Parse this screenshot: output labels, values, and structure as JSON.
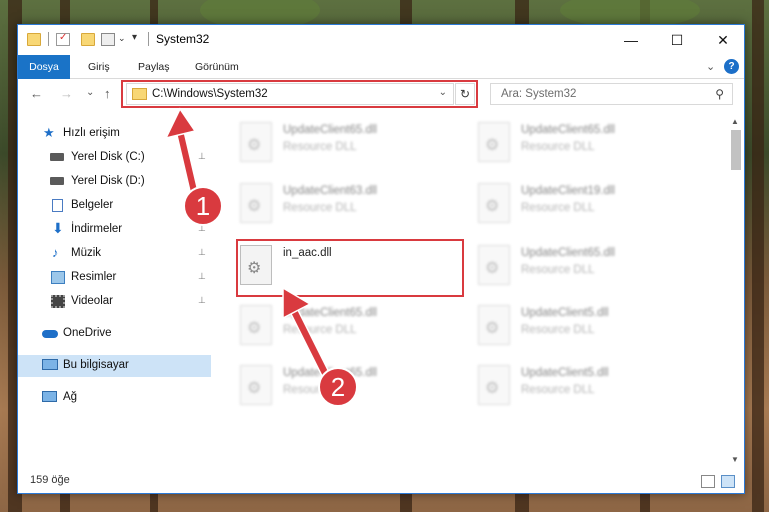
{
  "window": {
    "title": "System32",
    "controls": {
      "minimize": "—",
      "maximize": "☐",
      "close": "✕"
    }
  },
  "ribbon": {
    "tabs": [
      "Dosya",
      "Giriş",
      "Paylaş",
      "Görünüm"
    ],
    "collapse_glyph": "⌄",
    "help_glyph": "?"
  },
  "navigation": {
    "back": "←",
    "forward": "→",
    "recent": "⌄",
    "up": "↑",
    "address_path": "C:\\Windows\\System32",
    "address_dropdown": "⌄",
    "refresh": "↻",
    "search_placeholder": "Ara: System32",
    "search_icon": "⚲"
  },
  "sidebar": {
    "items": [
      {
        "label": "Hızlı erişim",
        "icon": "star-icon",
        "color": "#1e6fc8",
        "pinned": false
      },
      {
        "label": "Yerel Disk (C:)",
        "icon": "drive-icon",
        "color": "#5a5a5a",
        "pinned": true
      },
      {
        "label": "Yerel Disk (D:)",
        "icon": "drive-icon",
        "color": "#5a5a5a",
        "pinned": true
      },
      {
        "label": "Belgeler",
        "icon": "documents-icon",
        "color": "#4a7bc2",
        "pinned": true
      },
      {
        "label": "İndirmeler",
        "icon": "downloads-icon",
        "color": "#1e6fc8",
        "pinned": true
      },
      {
        "label": "Müzik",
        "icon": "music-icon",
        "color": "#1e6fc8",
        "pinned": true
      },
      {
        "label": "Resimler",
        "icon": "pictures-icon",
        "color": "#3d7fc0",
        "pinned": true
      },
      {
        "label": "Videolar",
        "icon": "videos-icon",
        "color": "#444444",
        "pinned": true
      },
      {
        "label": "OneDrive",
        "icon": "cloud-icon",
        "color": "#1e6fc8",
        "pinned": false
      },
      {
        "label": "Bu bilgisayar",
        "icon": "computer-icon",
        "color": "#3d7fc0",
        "pinned": false
      },
      {
        "label": "Ağ",
        "icon": "network-icon",
        "color": "#3d7fc0",
        "pinned": false
      }
    ],
    "pin_glyph": "📌"
  },
  "files": [
    {
      "name": "UpdateClient65.dll",
      "type": "Resource DLL",
      "blurred": true
    },
    {
      "name": "UpdateClient65.dll",
      "type": "Resource DLL",
      "blurred": true
    },
    {
      "name": "UpdateClient63.dll",
      "type": "Resource DLL",
      "blurred": true
    },
    {
      "name": "UpdateClient19.dll",
      "type": "Resource DLL",
      "blurred": true
    },
    {
      "name": "in_aac.dll",
      "type": "",
      "blurred": false
    },
    {
      "name": "UpdateClient65.dll",
      "type": "Resource DLL",
      "blurred": true
    },
    {
      "name": "UpdateClient65.dll",
      "type": "Resource DLL",
      "blurred": true
    },
    {
      "name": "UpdateClient5.dll",
      "type": "Resource DLL",
      "blurred": true
    },
    {
      "name": "UpdateClient65.dll",
      "type": "Resource DLL",
      "blurred": true
    },
    {
      "name": "UpdateClient5.dll",
      "type": "Resource DLL",
      "blurred": true
    }
  ],
  "status": {
    "item_count": "159 öğe"
  },
  "annotations": {
    "callouts": [
      "1",
      "2"
    ],
    "color": "#d93a3f"
  }
}
